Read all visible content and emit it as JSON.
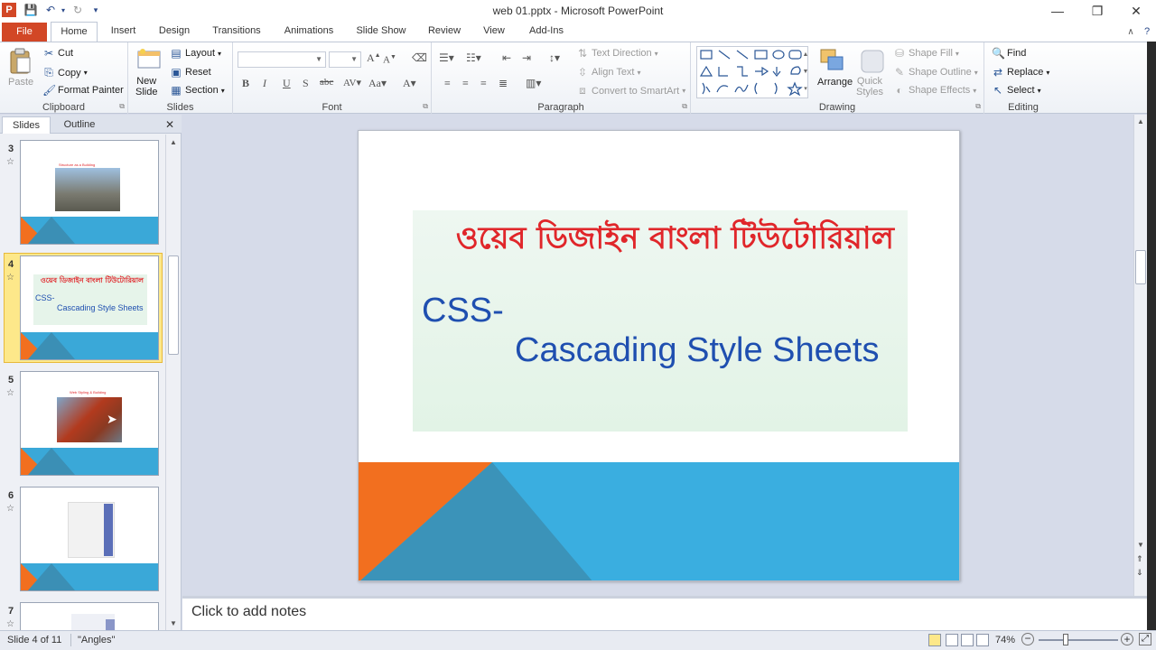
{
  "window": {
    "title": "web 01.pptx  -  Microsoft PowerPoint",
    "app_icon_letter": "P",
    "minimize": "—",
    "restore": "❐",
    "close": "✕"
  },
  "tabs": [
    "File",
    "Home",
    "Insert",
    "Design",
    "Transitions",
    "Animations",
    "Slide Show",
    "Review",
    "View",
    "Add-Ins"
  ],
  "active_tab": "Home",
  "ribbon": {
    "clipboard": {
      "label": "Clipboard",
      "paste": "Paste",
      "cut": "Cut",
      "copy": "Copy",
      "format_painter": "Format Painter"
    },
    "slides": {
      "label": "Slides",
      "new_slide": "New\nSlide",
      "layout": "Layout",
      "reset": "Reset",
      "section": "Section"
    },
    "font": {
      "label": "Font",
      "font_name": "",
      "font_size": ""
    },
    "paragraph": {
      "label": "Paragraph",
      "text_direction": "Text Direction",
      "align_text": "Align Text",
      "convert_smartart": "Convert to SmartArt"
    },
    "drawing": {
      "label": "Drawing",
      "arrange": "Arrange",
      "quick_styles": "Quick\nStyles",
      "shape_fill": "Shape Fill",
      "shape_outline": "Shape Outline",
      "shape_effects": "Shape Effects"
    },
    "editing": {
      "label": "Editing",
      "find": "Find",
      "replace": "Replace",
      "select": "Select"
    }
  },
  "left_panel": {
    "tabs": [
      "Slides",
      "Outline"
    ],
    "active": "Slides",
    "close": "✕",
    "thumbnails": [
      {
        "number": "3",
        "title": "Structure as a Building"
      },
      {
        "number": "4",
        "title_bangla": "ওয়েব ডিজাইন বাংলা টিউটোরিয়াল",
        "line1": "CSS-",
        "line2": "Cascading Style Sheets",
        "selected": true
      },
      {
        "number": "5",
        "title": "Web Styling & Building"
      },
      {
        "number": "6",
        "title": ""
      },
      {
        "number": "7",
        "title": ""
      }
    ]
  },
  "slide": {
    "title_bangla": "ওয়েব ডিজাইন বাংলা টিউটোরিয়াল",
    "line1": "CSS-",
    "line2": "Cascading Style Sheets"
  },
  "notes": {
    "placeholder": "Click to add notes"
  },
  "status": {
    "slide_info": "Slide 4 of 11",
    "theme": "\"Angles\"",
    "zoom": "74%"
  },
  "colors": {
    "accent_orange": "#f26f1f",
    "accent_blue": "#3aaee0",
    "accent_dark_blue": "#3b93b9",
    "title_red": "#e0262a",
    "body_blue": "#1f4fb0",
    "file_tab": "#d24726"
  }
}
